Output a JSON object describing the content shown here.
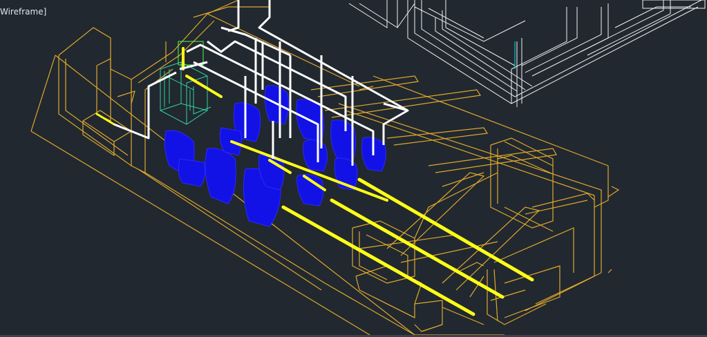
{
  "viewport": {
    "label": "Wireframe]",
    "background": "#212830"
  },
  "colors": {
    "building_outline": "#e1a92a",
    "fixtures": "#1717ff",
    "plumbing": "#ffffff",
    "drain_lines": "#ffff19",
    "tank": "#33d1a0",
    "structure_grid": "#f2f2f2"
  },
  "icons": [
    "toilet-fixture-icon",
    "pipe-network-icon"
  ]
}
